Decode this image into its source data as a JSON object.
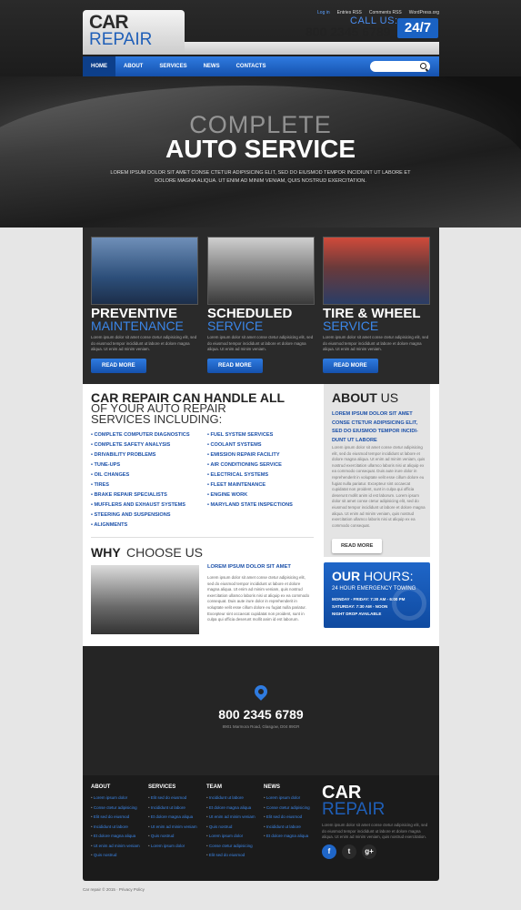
{
  "logo": {
    "line1": "CAR",
    "line2": "REPAIR"
  },
  "toplinks": [
    "Log in",
    "Entries RSS",
    "Comments RSS",
    "WordPress.org"
  ],
  "contact": {
    "call_label": "CALL US:",
    "phone": "800 2345 6789",
    "badge": "24/7"
  },
  "nav": [
    "HOME",
    "ABOUT",
    "SERVICES",
    "NEWS",
    "CONTACTS"
  ],
  "search": {
    "placeholder": ""
  },
  "hero": {
    "title1": "COMPLETE",
    "title2": "AUTO SERVICE",
    "text": "LOREM IPSUM DOLOR SIT AMET CONSE CTETUR ADIPISICING ELIT, SED DO EIUSMOD TEMPOR INCIDIUNT UT LABORE ET DOLORE MAGNA ALIQUA. UT ENIM AD MINIM VENIAM, QUIS NOSTRUD EXERCITATION."
  },
  "services": [
    {
      "t1": "PREVENTIVE",
      "t2": "MAINTENANCE",
      "text": "Lorem ipsum dolor sit amet conse ctetur adipisicing elit, sed do eiusmod tempor incididunt ut labore et dolore magna aliqua. Ut enim ad minim veniam.",
      "btn": "READ MORE"
    },
    {
      "t1": "SCHEDULED",
      "t2": "SERVICE",
      "text": "Lorem ipsum dolor sit amet conse ctetur adipisicing elit, sed do eiusmod tempor incididunt ut labore et dolore magna aliqua. Ut enim ad minim veniam.",
      "btn": "READ MORE"
    },
    {
      "t1": "TIRE & WHEEL",
      "t2": "SERVICE",
      "text": "Lorem ipsum dolor sit amet conse ctetur adipisicing elit, sed do eiusmod tempor incididunt ut labore et dolore magna aliqua. Ut enim ad minim veniam.",
      "btn": "READ MORE"
    }
  ],
  "handle": {
    "title1": "CAR REPAIR CAN HANDLE ALL",
    "title2": "OF YOUR AUTO REPAIR SERVICES INCLUDING:",
    "left": [
      "COMPLETE COMPUTER DIAGNOSTICS",
      "COMPLETE SAFETY ANALYSIS",
      "DRIVABILITY PROBLEMS",
      "TUNE-UPS",
      "OIL CHANGES",
      "TIRES",
      "BRAKE REPAIR SPECIALISTS",
      "MUFFLERS AND EXHAUST SYSTEMS",
      "STEERING AND SUSPENSIONS",
      "ALIGNMENTS"
    ],
    "right": [
      "FUEL SYSTEM SERVICES",
      "COOLANT SYSTEMS",
      "EMISSION REPAIR FACILITY",
      "AIR CONDITIONING SERVICE",
      "ELECTRICAL SYSTEMS",
      "FLEET MAINTENANCE",
      "ENGINE WORK",
      "MARYLAND STATE INSPECTIONS"
    ]
  },
  "why": {
    "title1": "WHY",
    "title2": "CHOOSE US",
    "heading": "LOREM IPSUM DOLOR SIT AMET",
    "text": "Lorem ipsum dolor sit amet conse ctetur adipisicing elit, sed do eiusmod tempor incididunt ut labore et dolore magna aliqua. Ut enim ad minim veniam, quis nostrud exercitation ullamco laboris nisi ut aliquip ex ea commodo consequat. Duis aute irure dolor in reprehenderit in voluptate velit esse cillum dolore eu fugiat nulla pariatur. Excepteur sint occaecat cupidatat non proident, sunt in culpa qui officia deserunt mollit anim id est laborum."
  },
  "about": {
    "title1": "ABOUT",
    "title2": "US",
    "sub": "LOREM IPSUM DOLOR SIT AMET CONSE CTETUR ADIPISICING ELIT, SED DO EIUSMOD TEMPOR INCIDI-DUNT UT LABORE",
    "text": "Lorem ipsum dolor sit amet conse ctetur adipisicing elit, sed do eiusmod tempor incididunt ut labore et dolore magna aliqua. Ut enim ad minim veniam, quis nostrud exercitation ullamco laboris nisi ut aliquip ex ea commodo consequat. Duis aute irure dolor in reprehenderit in voluptate velit esse cillum dolore eu fugiat nulla pariatur. Excepteur sint occaecat cupidatat non proident, sunt in culpa qui officia deserunt mollit anim id est laborum. Lorem ipsum dolor sit amet conse ctetur adipisicing elit, sed do eiusmod tempor incididunt ut labore et dolore magna aliqua. Ut enim ad minim veniam, quis nostrud exercitation ullamco laboris nisi ut aliquip ex ea commodo consequat.",
    "btn": "READ MORE"
  },
  "hours": {
    "title1": "OUR",
    "title2": "HOURS:",
    "sub": "24 HOUR EMERGENCY TOWING",
    "line1": "MONDAY - FRIDAY: 7:30 AM - 6:00 PM",
    "line2": "SATURDAY: 7:30 AM - NOON",
    "line3": "NIGHT DROP AVAILABLE"
  },
  "map": {
    "phone": "800 2345 6789",
    "address": "8901 Marmora Road, Glasgow, D04 89GR"
  },
  "footer": {
    "cols": [
      {
        "title": "ABOUT",
        "items": [
          "Lorem ipsum dolor",
          "Conse ctetur adipisicing",
          "Elit sed do eiusmod",
          "Incididunt ut labore",
          "Et dolore magna aliqua",
          "Ut enim ad minim veniam",
          "Quis nostrud"
        ]
      },
      {
        "title": "SERVICES",
        "items": [
          "Elit sed do eiusmod",
          "Incididunt ut labore",
          "Et dolore magna aliqua",
          "Ut enim ad minim veniam",
          "Quis nostrud",
          "Lorem ipsum dolor"
        ]
      },
      {
        "title": "TEAM",
        "items": [
          "Incididunt ut labore",
          "Et dolore magna aliqua",
          "Ut enim ad minim veniam",
          "Quis nostrud",
          "Lorem ipsum dolor",
          "Conse ctetur adipisicing",
          "Elit sed do eiusmod"
        ]
      },
      {
        "title": "NEWS",
        "items": [
          "Lorem ipsum dolor",
          "Conse ctetur adipisicing",
          "Elit sed do eiusmod",
          "Incididunt ut labore",
          "Et dolore magna aliqua"
        ]
      }
    ],
    "logo1": "CAR",
    "logo2": "REPAIR",
    "text": "Lorem ipsum dolor sit amet conse ctetur adipisicing elit, sed do eiusmod tempor incididunt ut labore et dolore magna aliqua. Ut enim ad minim veniam, quis nostrud exercitation.",
    "social": [
      "f",
      "t",
      "g+"
    ]
  },
  "copyright": "Car repair © 2015 · Privacy Policy"
}
